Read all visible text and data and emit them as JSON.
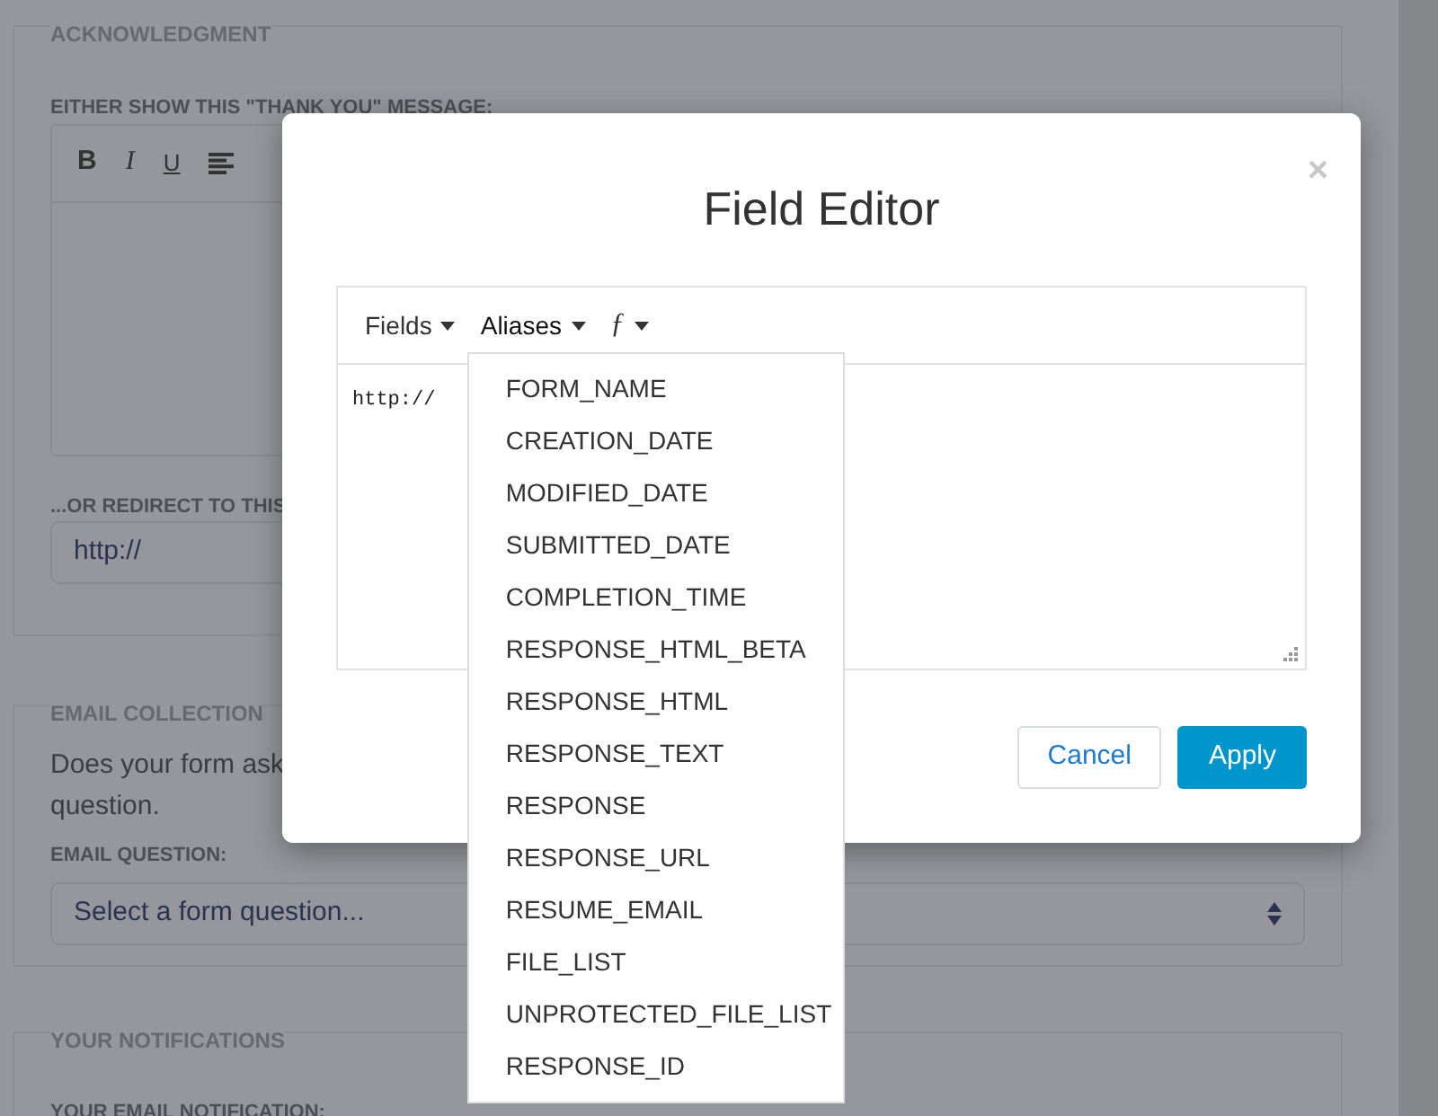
{
  "page": {
    "acknowledgment": {
      "legend": "ACKNOWLEDGMENT",
      "message_label": "EITHER SHOW THIS \"THANK YOU\" MESSAGE:",
      "toolbar": [
        {
          "kind": "bold",
          "label": "B"
        },
        {
          "kind": "italic",
          "label": "I"
        },
        {
          "kind": "underline",
          "label": "U"
        },
        {
          "kind": "align"
        }
      ],
      "redirect_label": "...OR REDIRECT TO THIS",
      "redirect_value": "http://"
    },
    "email_collection": {
      "legend": "EMAIL COLLECTION",
      "text_lines": [
        "Does your form ask",
        "question."
      ],
      "question_label": "EMAIL QUESTION:",
      "select_value": "Select a form question..."
    },
    "notifications": {
      "legend": "YOUR NOTIFICATIONS",
      "label": "YOUR EMAIL NOTIFICATION:"
    }
  },
  "modal": {
    "title": "Field Editor",
    "close_label": "×",
    "toolbar": [
      {
        "label": "Fields",
        "expanded": false
      },
      {
        "label": "Aliases",
        "expanded": true
      },
      {
        "label": "ƒ",
        "expanded": false
      }
    ],
    "editor": {
      "value": "http://"
    },
    "dropdown": {
      "items": [
        "FORM_NAME",
        "CREATION_DATE",
        "MODIFIED_DATE",
        "SUBMITTED_DATE",
        "COMPLETION_TIME",
        "RESPONSE_HTML_BETA",
        "RESPONSE_HTML",
        "RESPONSE_TEXT",
        "RESPONSE",
        "RESPONSE_URL",
        "RESUME_EMAIL",
        "FILE_LIST",
        "UNPROTECTED_FILE_LIST",
        "RESPONSE_ID"
      ]
    },
    "buttons": [
      {
        "label": "Cancel",
        "kind": "secondary"
      },
      {
        "label": "Apply",
        "kind": "primary"
      }
    ]
  }
}
